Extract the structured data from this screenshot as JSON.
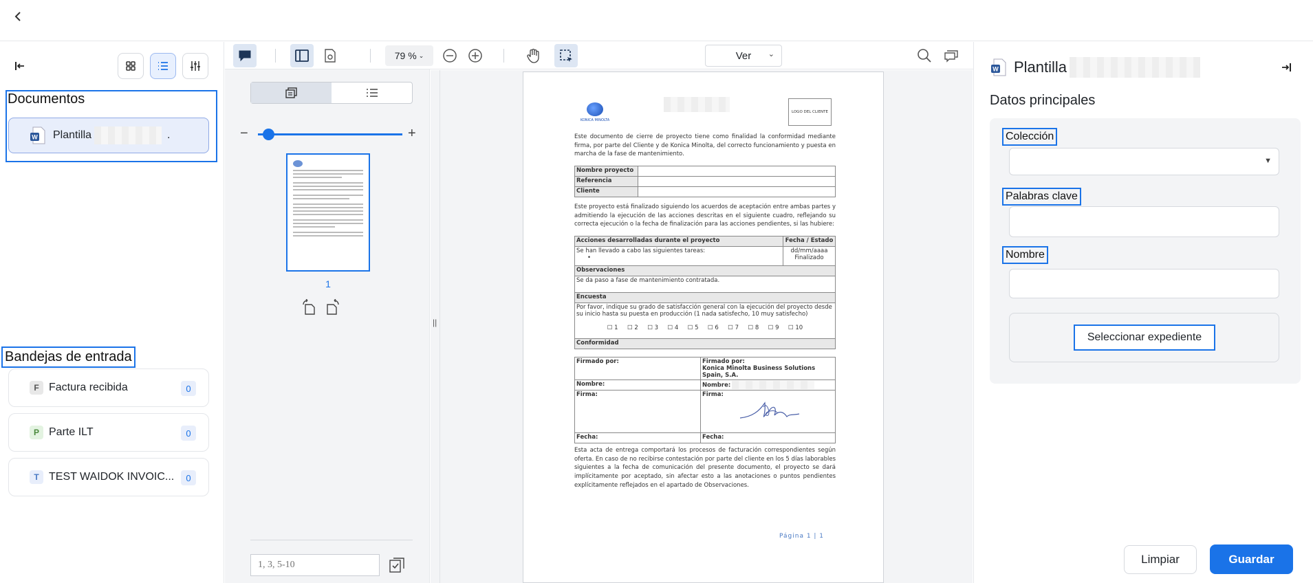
{
  "left": {
    "documents_title": "Documentos",
    "document_item": {
      "label": "Plantilla",
      "suffix": "."
    },
    "inboxes_title": "Bandejas de entrada",
    "inboxes": [
      {
        "letter": "F",
        "label": "Factura recibida",
        "count": "0",
        "color": "#e8e8e8",
        "text_color": "#555"
      },
      {
        "letter": "P",
        "label": "Parte ILT",
        "count": "0",
        "color": "#e3f3e1",
        "text_color": "#4a8a3c"
      },
      {
        "letter": "T",
        "label": "TEST WAIDOK INVOIC...",
        "count": "0",
        "color": "#e8eefb",
        "text_color": "#4a7ac4"
      }
    ]
  },
  "toolbar": {
    "zoom": "79 %",
    "view_select": "Ver"
  },
  "thumbs": {
    "page_number": "1",
    "page_input_placeholder": "1, 3, 5-10"
  },
  "document": {
    "intro": "Este documento de cierre de proyecto tiene como finalidad la conformidad mediante firma, por parte del Cliente y de Konica Minolta, del correcto funcionamiento y puesta en marcha de la fase de mantenimiento.",
    "logo_company": "KONICA MINOLTA",
    "logo_client": "LOGO DEL CLIENTE",
    "table1": [
      "Nombre proyecto",
      "Referencia",
      "Cliente"
    ],
    "para2": "Este proyecto está finalizado siguiendo los acuerdos de aceptación entre ambas partes y admitiendo la ejecución de las acciones descritas en el siguiente cuadro, reflejando su correcta ejecución o la fecha de finalización para las acciones pendientes, si las hubiere:",
    "actions_header": "Acciones desarrolladas durante el proyecto",
    "date_header": "Fecha / Estado",
    "actions_text": "Se han llevado a cabo las siguientes tareas:",
    "bullet": "•",
    "date_value": "dd/mm/aaaa",
    "status_value": "Finalizado",
    "observations_header": "Observaciones",
    "observations_text": "Se da paso a fase de mantenimiento contratada.",
    "survey_header": "Encuesta",
    "survey_text": "Por favor, indique su grado de satisfacción general con la ejecución del proyecto desde su inicio hasta su puesta en producción (1 nada satisfecho, 10 muy satisfecho)",
    "survey_options": "☐ 1     ☐ 2     ☐ 3     ☐ 4     ☐ 5     ☐ 6     ☐ 7     ☐ 8     ☐ 9     ☐ 10",
    "conformity_header": "Conformidad",
    "signed_by_left": "Firmado por:",
    "signed_by_right": "Firmado por:",
    "signed_company": "Konica Minolta Business Solutions Spain, S.A.",
    "name_left": "Nombre:",
    "name_right": "Nombre:",
    "signature_left": "Firma:",
    "signature_right": "Firma:",
    "date_left": "Fecha:",
    "date_right": "Fecha:",
    "closing": "Esta acta de entrega comportará los procesos de facturación correspondientes según oferta. En caso de no recibirse contestación por parte del cliente en los 5 días laborables siguientes a la fecha de comunicación del presente documento, el proyecto se dará implícitamente por aceptado, sin afectar esto a las anotaciones o puntos pendientes explícitamente reflejados en el apartado de Observaciones.",
    "footer": "Página 1 | 1"
  },
  "right": {
    "title": "Plantilla",
    "section_title": "Datos principales",
    "coleccion_label": "Colección",
    "palabras_label": "Palabras clave",
    "nombre_label": "Nombre",
    "select_expediente": "Seleccionar expediente",
    "clear_button": "Limpiar",
    "save_button": "Guardar"
  },
  "colors": {
    "accent": "#1a73e8"
  }
}
